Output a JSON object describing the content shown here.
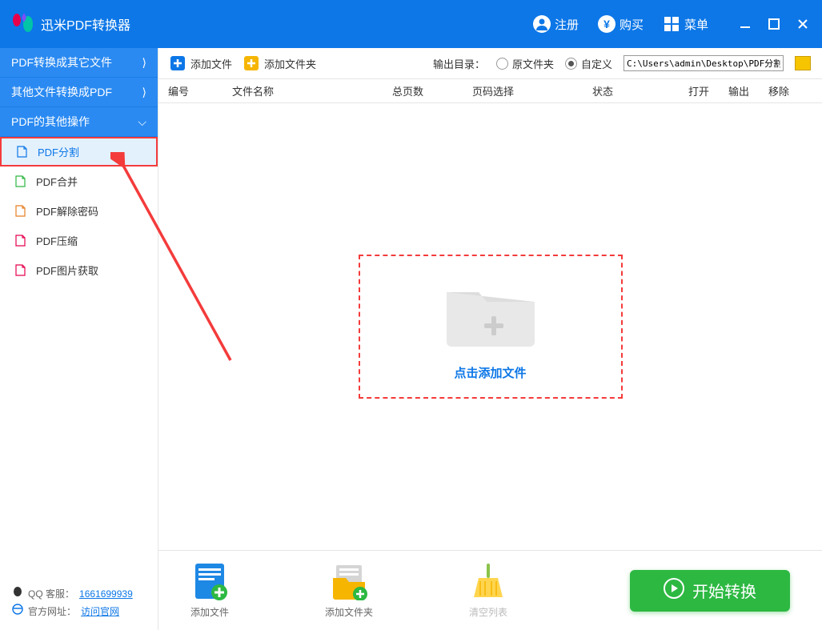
{
  "app": {
    "title": "迅米PDF转换器"
  },
  "titlebar": {
    "register": "注册",
    "buy": "购买",
    "menu": "菜单"
  },
  "sidebar": {
    "groups": [
      {
        "label": "PDF转换成其它文件",
        "arrow": "⟩"
      },
      {
        "label": "其他文件转换成PDF",
        "arrow": "⟩"
      },
      {
        "label": "PDF的其他操作",
        "arrow": "⌵"
      }
    ],
    "items": [
      {
        "label": "PDF分割",
        "selected": true
      },
      {
        "label": "PDF合并"
      },
      {
        "label": "PDF解除密码"
      },
      {
        "label": "PDF压缩"
      },
      {
        "label": "PDF图片获取"
      }
    ],
    "footer": {
      "qq_label": "QQ 客服：",
      "qq_value": "1661699939",
      "site_label": "官方网址：",
      "site_value": "访问官网"
    }
  },
  "toolbar": {
    "add_file": "添加文件",
    "add_folder": "添加文件夹",
    "output_label": "输出目录：",
    "opt_source": "原文件夹",
    "opt_custom": "自定义",
    "path": "C:\\Users\\admin\\Desktop\\PDF分割"
  },
  "table": {
    "cols": {
      "num": "编号",
      "name": "文件名称",
      "pages": "总页数",
      "sel": "页码选择",
      "status": "状态",
      "open": "打开",
      "out": "输出",
      "del": "移除"
    }
  },
  "dropzone": {
    "label": "点击添加文件"
  },
  "bottom": {
    "add_file": "添加文件",
    "add_folder": "添加文件夹",
    "clear": "清空列表",
    "start": "开始转换"
  }
}
